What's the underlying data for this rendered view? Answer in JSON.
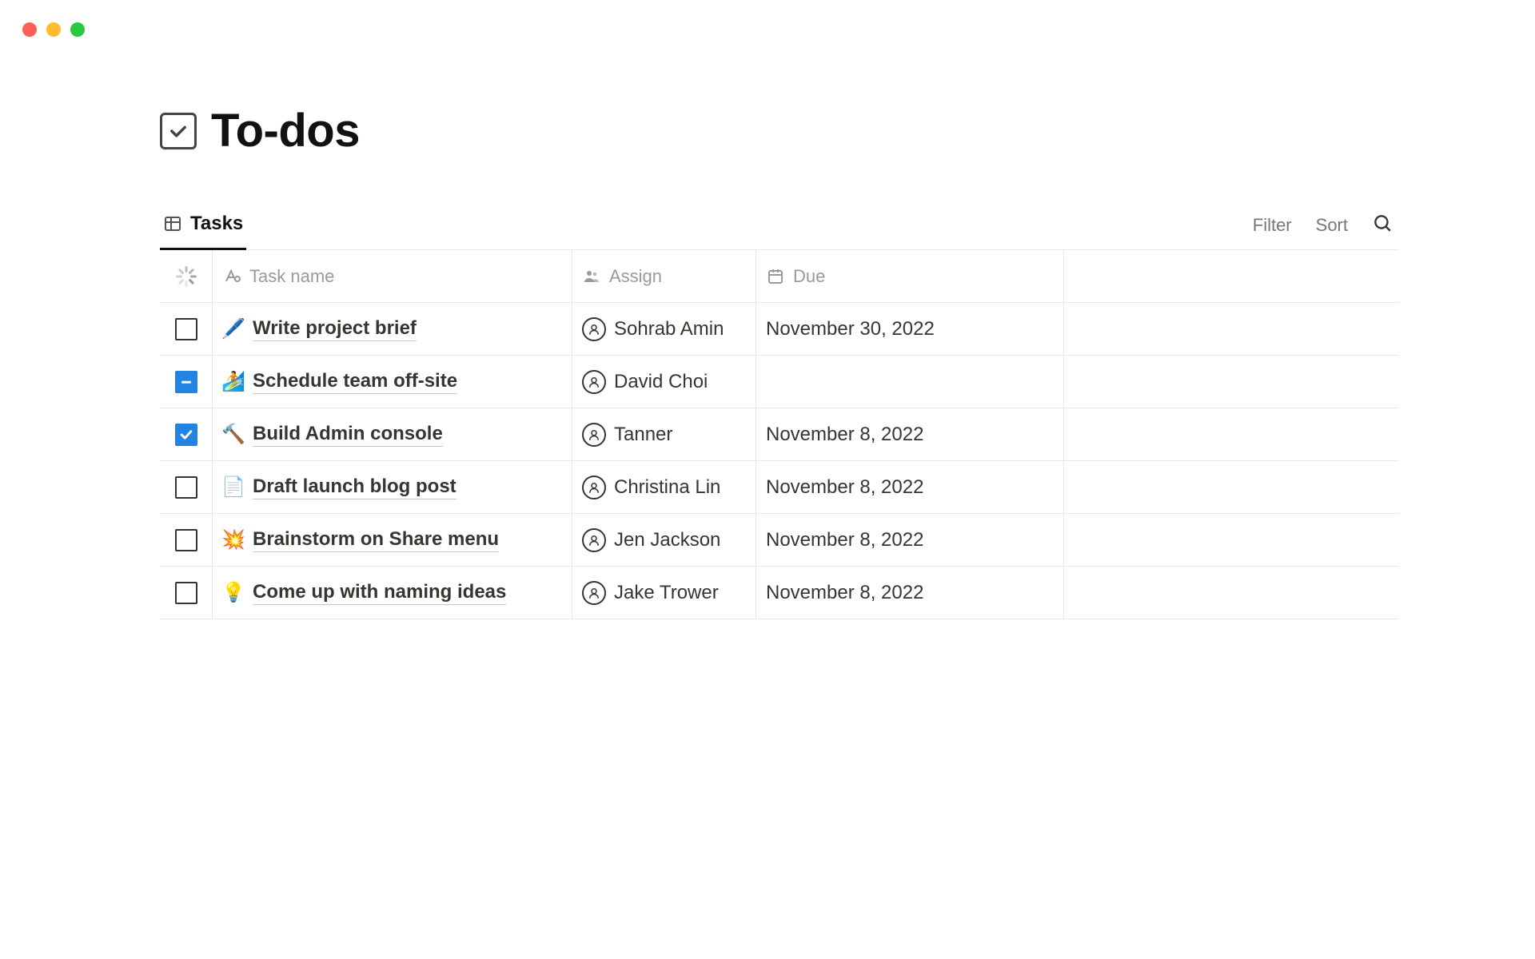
{
  "title": "To-dos",
  "view": {
    "active_tab": "Tasks",
    "actions": {
      "filter": "Filter",
      "sort": "Sort"
    }
  },
  "columns": {
    "task_name": "Task name",
    "assign": "Assign",
    "due": "Due"
  },
  "rows": [
    {
      "checked": "empty",
      "emoji": "🖊️",
      "name": "Write project brief",
      "assignee": "Sohrab Amin",
      "due": "November 30, 2022"
    },
    {
      "checked": "indeterminate",
      "emoji": "🏄",
      "name": "Schedule team off-site",
      "assignee": "David Choi",
      "due": ""
    },
    {
      "checked": "checked",
      "emoji": "🔨",
      "name": "Build Admin console",
      "assignee": "Tanner",
      "due": "November 8, 2022"
    },
    {
      "checked": "empty",
      "emoji": "📄",
      "name": "Draft launch blog post",
      "assignee": "Christina Lin",
      "due": "November 8, 2022"
    },
    {
      "checked": "empty",
      "emoji": "💥",
      "name": "Brainstorm on Share menu",
      "assignee": "Jen Jackson",
      "due": "November 8, 2022"
    },
    {
      "checked": "empty",
      "emoji": "💡",
      "name": "Come up with naming ideas",
      "assignee": "Jake Trower",
      "due": "November 8, 2022"
    }
  ]
}
